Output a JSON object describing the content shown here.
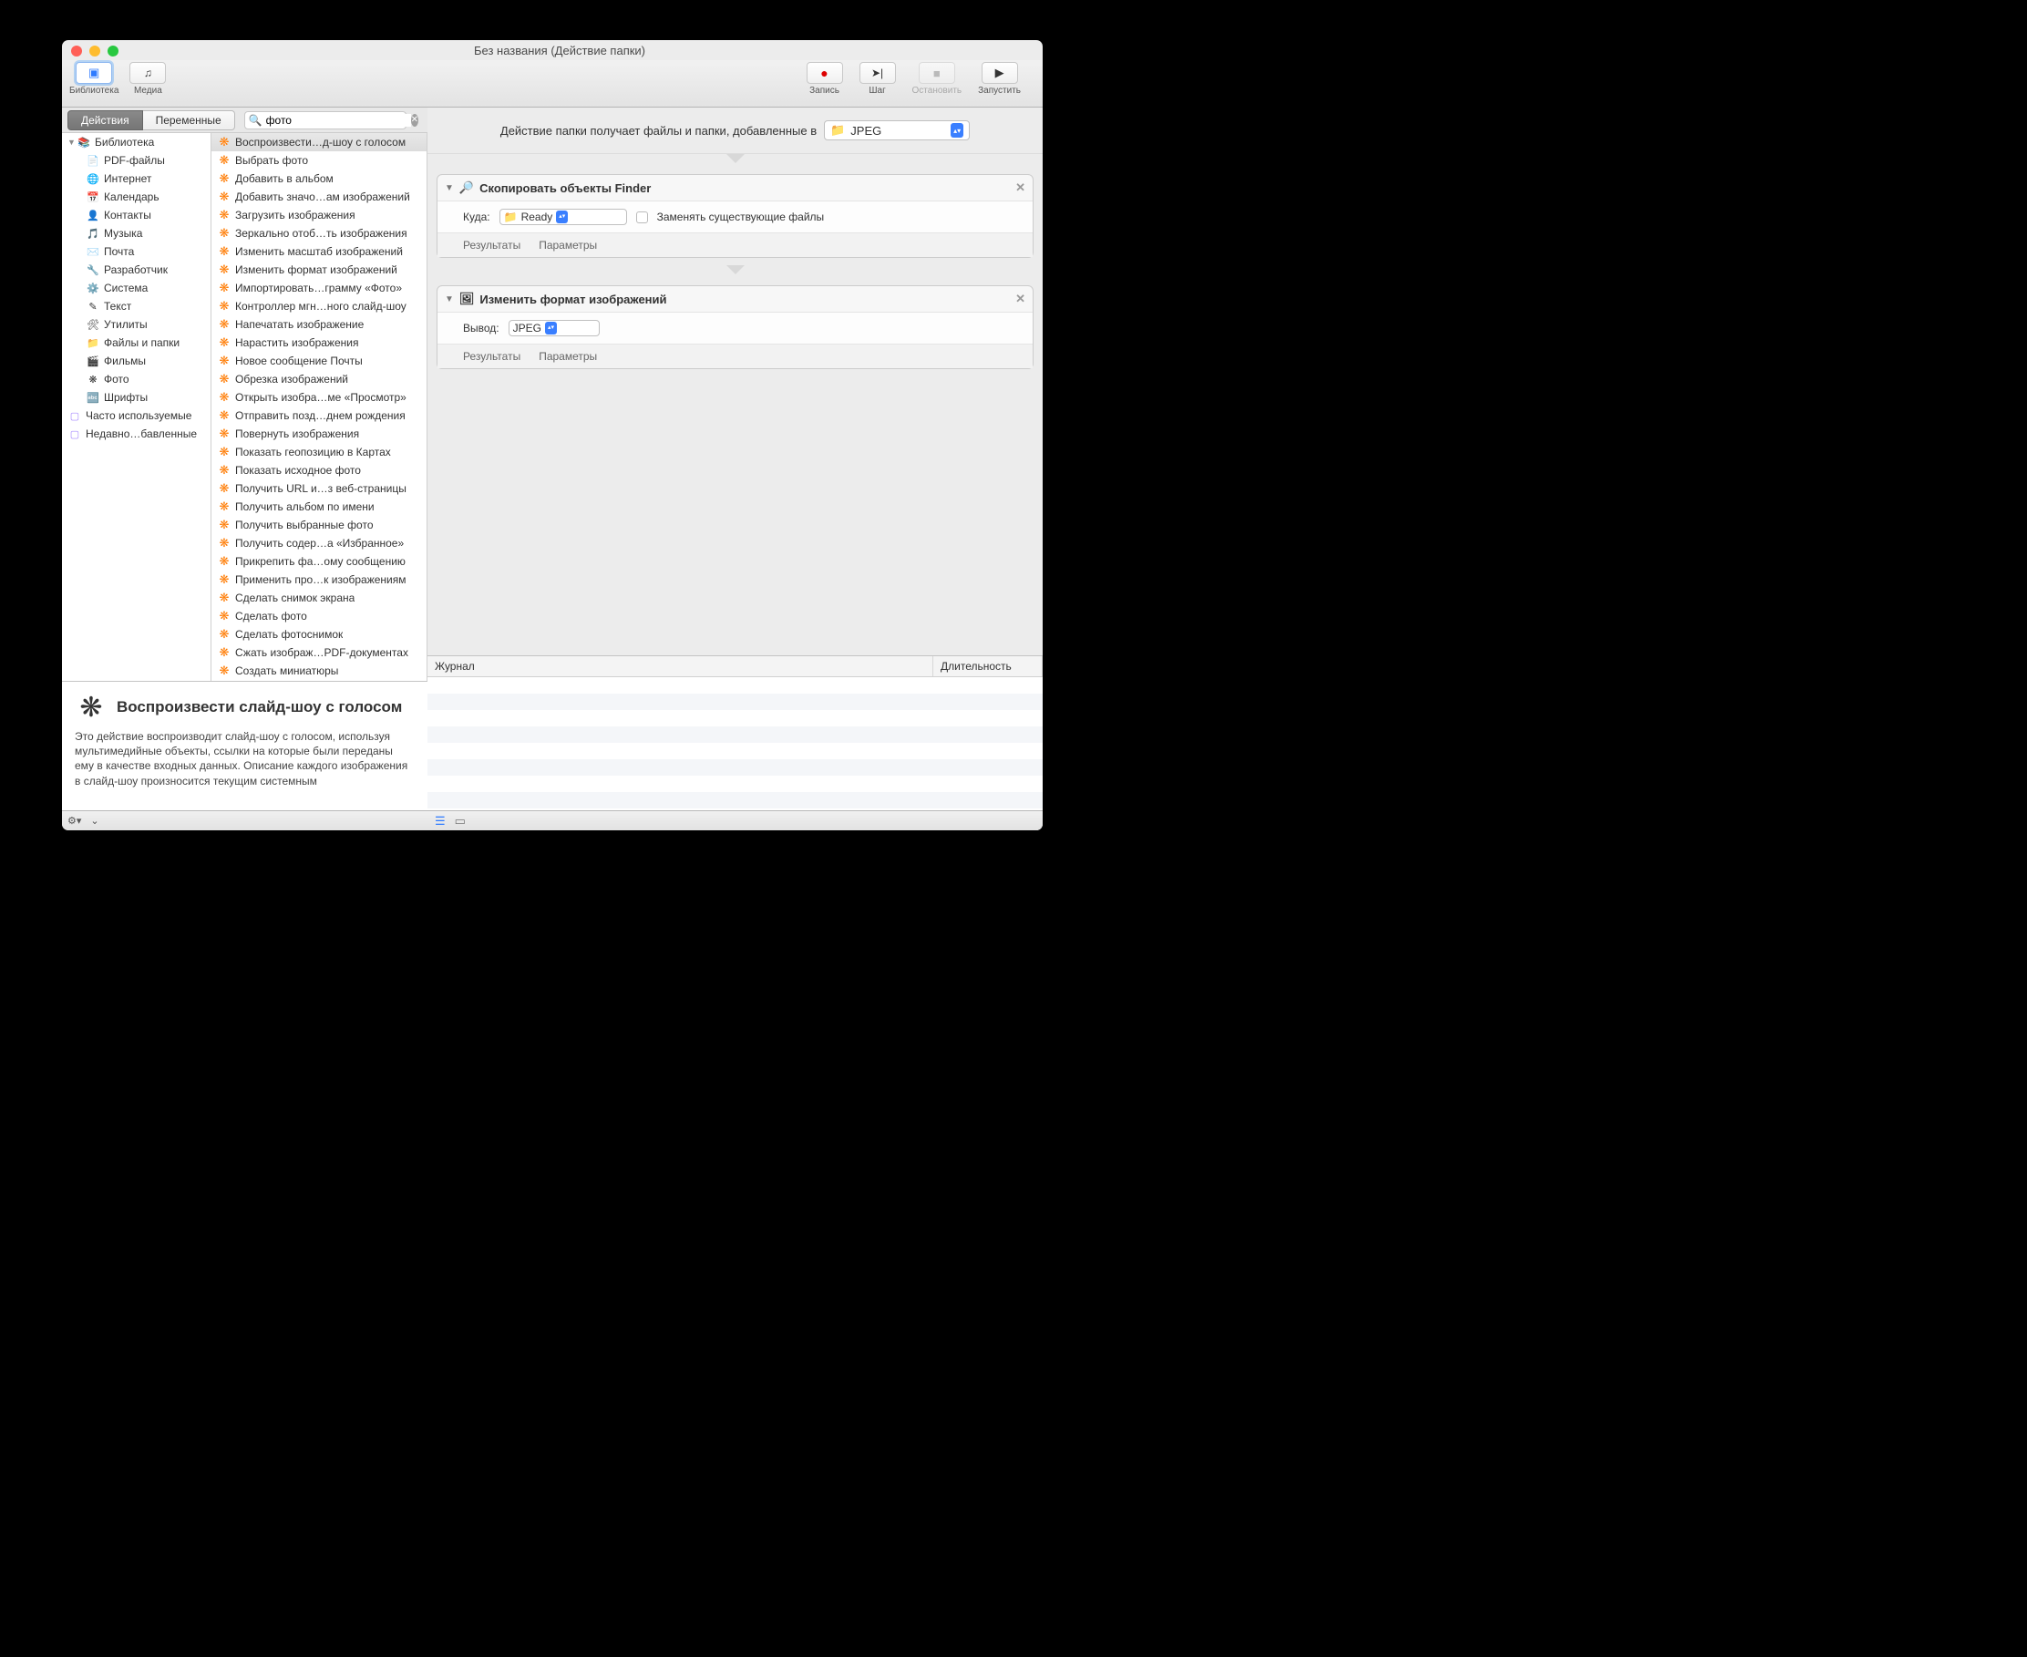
{
  "window": {
    "title": "Без названия (Действие папки)"
  },
  "toolbar": {
    "library": "Библиотека",
    "media": "Медиа",
    "record": "Запись",
    "step": "Шаг",
    "stop": "Остановить",
    "run": "Запустить"
  },
  "tabs": {
    "actions": "Действия",
    "variables": "Переменные"
  },
  "search": {
    "value": "фото"
  },
  "sidebar": {
    "library": "Библиотека",
    "items": [
      "PDF-файлы",
      "Интернет",
      "Календарь",
      "Контакты",
      "Музыка",
      "Почта",
      "Разработчик",
      "Система",
      "Текст",
      "Утилиты",
      "Файлы и папки",
      "Фильмы",
      "Фото",
      "Шрифты"
    ],
    "recent1": "Часто используемые",
    "recent2": "Недавно…бавленные"
  },
  "actions": [
    "Воспроизвести…д-шоу с голосом",
    "Выбрать фото",
    "Добавить в альбом",
    "Добавить значо…ам изображений",
    "Загрузить изображения",
    "Зеркально отоб…ть изображения",
    "Изменить масштаб изображений",
    "Изменить формат изображений",
    "Импортировать…грамму «Фото»",
    "Контроллер мгн…ного слайд-шоу",
    "Напечатать изображение",
    "Нарастить изображения",
    "Новое сообщение Почты",
    "Обрезка изображений",
    "Открыть изобра…ме «Просмотр»",
    "Отправить позд…днем рождения",
    "Повернуть изображения",
    "Показать геопозицию в Картах",
    "Показать исходное фото",
    "Получить URL и…з веб-страницы",
    "Получить альбом по имени",
    "Получить выбранные фото",
    "Получить содер…а «Избранное»",
    "Прикрепить фа…ому сообщению",
    "Применить про…к изображениям",
    "Сделать снимок экрана",
    "Сделать фото",
    "Сделать фотоснимок",
    "Сжать изображ…PDF-документах",
    "Создать миниатюры"
  ],
  "workflow": {
    "header_text": "Действие папки получает файлы и папки, добавленные в",
    "header_select": "JPEG",
    "block1": {
      "title": "Скопировать объекты Finder",
      "dest_label": "Куда:",
      "dest_value": "Ready",
      "replace_label": "Заменять существующие файлы",
      "results": "Результаты",
      "params": "Параметры"
    },
    "block2": {
      "title": "Изменить формат изображений",
      "output_label": "Вывод:",
      "output_value": "JPEG",
      "results": "Результаты",
      "params": "Параметры"
    }
  },
  "log": {
    "col1": "Журнал",
    "col2": "Длительность"
  },
  "description": {
    "title": "Воспроизвести слайд-шоу с голосом",
    "body": "Это действие воспроизводит слайд-шоу с голосом, используя мультимедийные объекты, ссылки на которые были переданы ему в качестве входных данных. Описание каждого изображения в слайд-шоу произносится текущим системным"
  }
}
